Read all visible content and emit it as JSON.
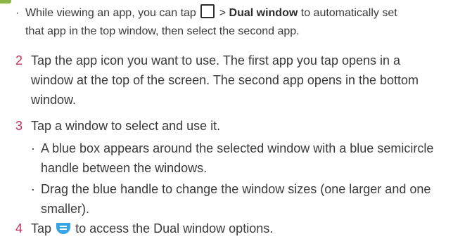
{
  "tip": {
    "part1": "While viewing an app, you can tap",
    "arrow": ">",
    "bold": "Dual window",
    "part2": "to automatically set",
    "line2": "that app in the top window, then select the second app."
  },
  "steps": [
    {
      "num": "2",
      "lines": [
        "Tap the app icon you want to use. The first app you tap opens in a",
        "window at the top of the screen. The second app opens in the bottom",
        "window."
      ]
    },
    {
      "num": "3",
      "lines": [
        "Tap a window to select and use it."
      ],
      "bullets": [
        [
          "A blue box appears around the selected window with a blue semicircle",
          "handle between the windows."
        ],
        [
          "Drag the blue handle to change the window sizes (one larger and one",
          "smaller)."
        ]
      ]
    },
    {
      "num": "4",
      "pre": "Tap",
      "post": "to access the Dual window options."
    }
  ],
  "icons": {
    "square": "square-button-icon",
    "menu": "menu-handle-icon"
  },
  "colors": {
    "step_number": "#c8315a",
    "menu_icon": "#36a6e6",
    "top_mark": "#8ab64a"
  }
}
